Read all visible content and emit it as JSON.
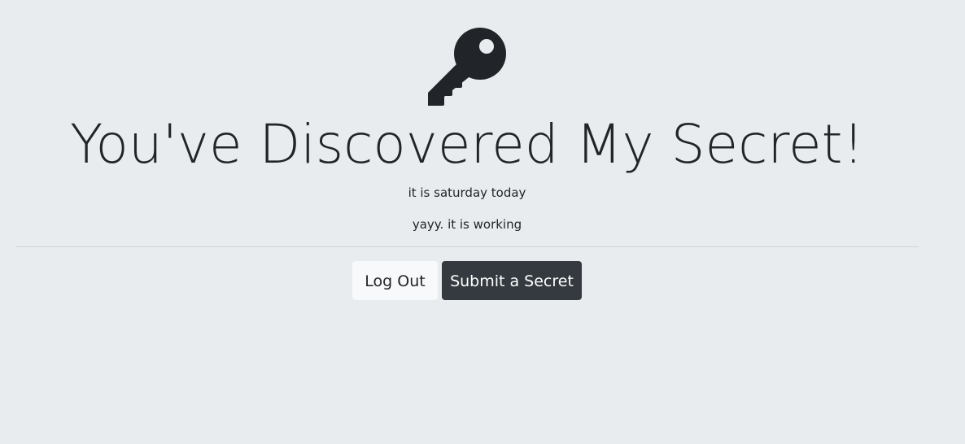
{
  "page": {
    "title": "You've Discovered My Secret!",
    "icon": "key-icon",
    "background_color": "#e9ecef",
    "text_color": "#212529"
  },
  "secrets": [
    "it is saturday today",
    "yayy. it is working"
  ],
  "actions": {
    "logout_label": "Log Out",
    "submit_label": "Submit a Secret",
    "logout_color": "#f8f9fa",
    "submit_color": "#343a40"
  }
}
